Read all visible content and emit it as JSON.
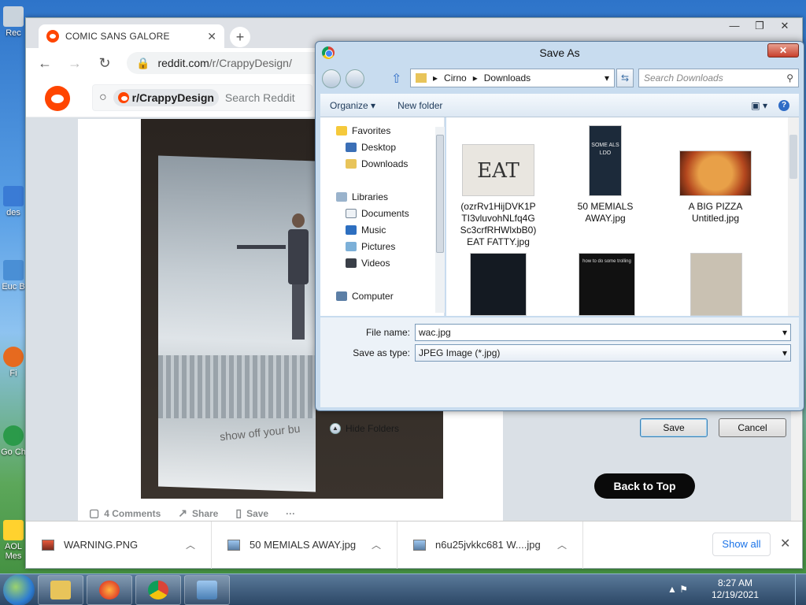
{
  "desktop": {
    "icons": [
      "Rec",
      "des",
      "Euc B",
      "Fi",
      "Go Ch",
      "AOL Mes"
    ]
  },
  "browser": {
    "tab_title": "COMIC SANS GALORE",
    "tab_close": "✕",
    "new_tab": "+",
    "url_host": "reddit.com",
    "url_path": "/r/CrappyDesign/",
    "window_controls": {
      "minimize": "—",
      "maximize": "❐",
      "close": "✕"
    }
  },
  "reddit": {
    "subreddit_chip": "r/CrappyDesign",
    "search_placeholder": "Search Reddit",
    "billboard_text": "show off your bu",
    "actions": {
      "comments": "4 Comments",
      "share": "Share",
      "save": "Save",
      "more": "···"
    },
    "back_to_top": "Back to Top"
  },
  "downloads": {
    "items": [
      {
        "name": "WARNING.PNG"
      },
      {
        "name": "50 MEMIALS AWAY.jpg"
      },
      {
        "name": "n6u25jvkkc681 W....jpg"
      }
    ],
    "show_all": "Show all",
    "close": "✕"
  },
  "dialog": {
    "title": "Save As",
    "close": "✕",
    "breadcrumb": [
      "Cirno",
      "Downloads"
    ],
    "search_placeholder": "Search Downloads",
    "organize": "Organize ▾",
    "new_folder": "New folder",
    "nav": {
      "favorites": "Favorites",
      "desktop": "Desktop",
      "downloads": "Downloads",
      "libraries": "Libraries",
      "documents": "Documents",
      "music": "Music",
      "pictures": "Pictures",
      "videos": "Videos",
      "computer": "Computer"
    },
    "files": [
      {
        "name": "(ozrRv1HijDVK1P TI3vluvohNLfq4G Sc3crfRHWlxbB0) EAT FATTY.jpg",
        "thumb_text": "EAT"
      },
      {
        "name": "50 MEMIALS AWAY.jpg",
        "thumb_text": "SOME ALS LDO"
      },
      {
        "name": "A BIG PIZZA Untitled.jpg"
      },
      {
        "name": ""
      },
      {
        "name": "",
        "thumb_text": "how to do some trolling"
      },
      {
        "name": ""
      }
    ],
    "file_name_label": "File name:",
    "file_name_value": "wac.jpg",
    "save_as_type_label": "Save as type:",
    "save_as_type_value": "JPEG Image (*.jpg)",
    "hide_folders": "Hide Folders",
    "save": "Save",
    "cancel": "Cancel"
  },
  "taskbar": {
    "time": "8:27 AM",
    "date": "12/19/2021"
  }
}
